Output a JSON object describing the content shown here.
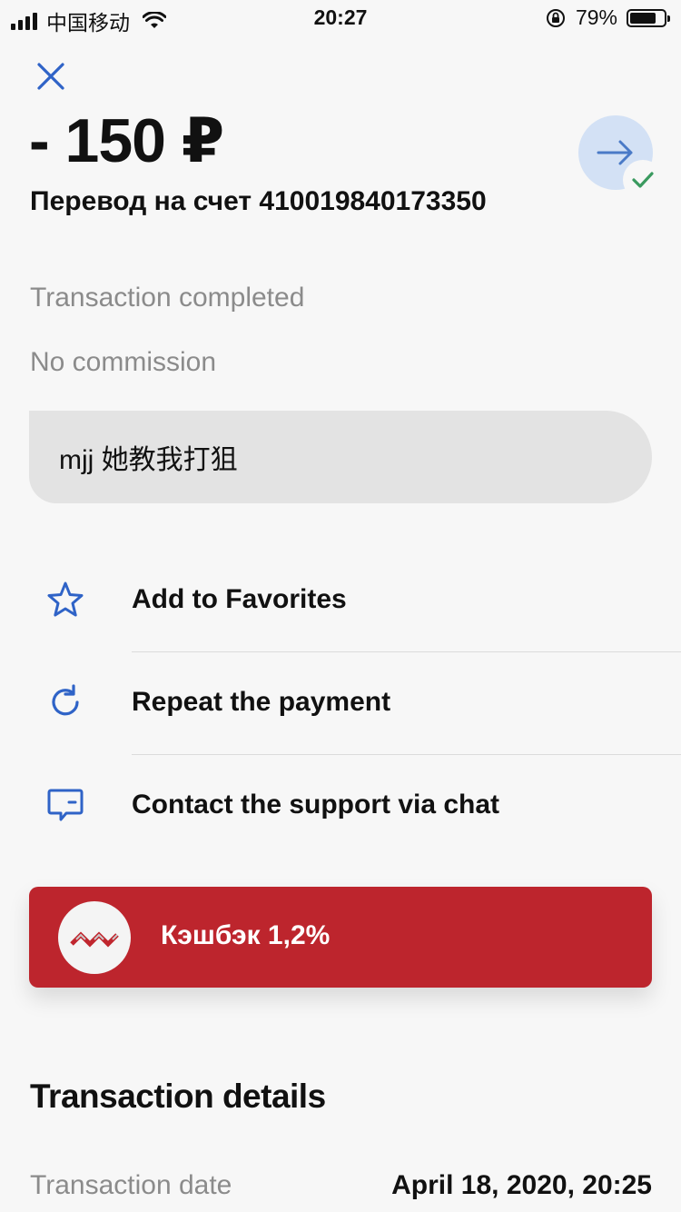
{
  "status_bar": {
    "carrier": "中国移动",
    "time": "20:27",
    "battery": "79%",
    "battery_level": 0.79
  },
  "header": {
    "close_icon": "close-icon",
    "amount": "- 150 ₽",
    "title": "Перевод на счет 410019840173350",
    "avatar_icon": "arrow-right-icon",
    "check_icon": "check-icon"
  },
  "status": {
    "completed": "Transaction completed",
    "commission": "No commission"
  },
  "comment": "mjj 她教我打狙",
  "actions": [
    {
      "label": "Add to Favorites",
      "icon": "star-icon"
    },
    {
      "label": "Repeat the payment",
      "icon": "refresh-icon"
    },
    {
      "label": "Contact the support via chat",
      "icon": "chat-icon"
    }
  ],
  "cashback": {
    "label": "Кэшбэк 1,2%",
    "icon": "bank-logo"
  },
  "details": {
    "title": "Transaction details",
    "rows": [
      {
        "label": "Transaction date",
        "value": "April 18, 2020, 20:25"
      }
    ]
  },
  "colors": {
    "accent": "#2f63c7",
    "cashback_bg": "#bd252d",
    "check": "#3a9a5f"
  }
}
